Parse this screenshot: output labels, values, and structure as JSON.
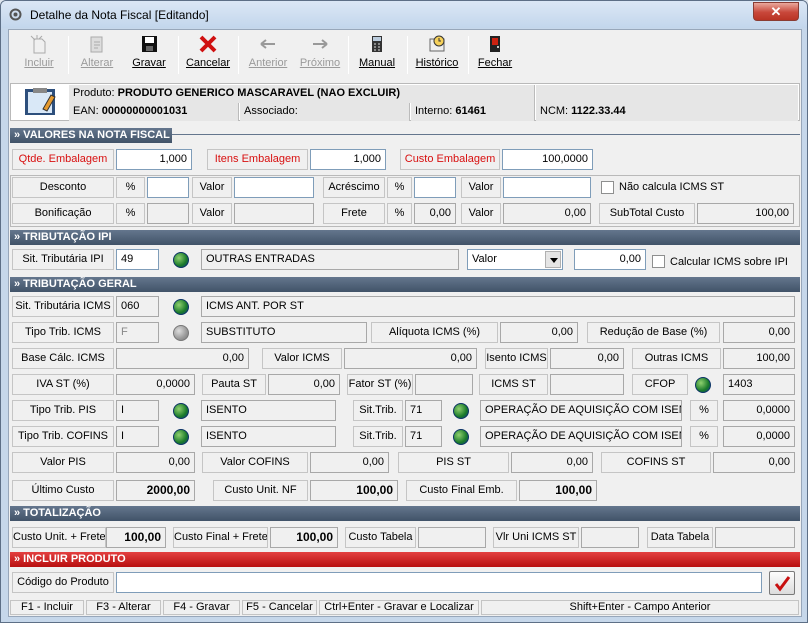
{
  "window": {
    "title": "Detalhe da Nota Fiscal [Editando]",
    "close_label": "✕"
  },
  "toolbar": {
    "incluir": "Incluir",
    "alterar": "Alterar",
    "gravar": "Gravar",
    "cancelar": "Cancelar",
    "anterior": "Anterior",
    "proximo": "Próximo",
    "manual": "Manual",
    "historico": "Histórico",
    "fechar": "Fechar"
  },
  "product": {
    "produto_label": "Produto:",
    "produto_value": "PRODUTO GENERICO MASCARAVEL (NAO EXCLUIR)",
    "ean_label": "EAN:",
    "ean_value": "00000000001031",
    "associado_label": "Associado:",
    "associado_value": "",
    "interno_label": "Interno:",
    "interno_value": "61461",
    "ncm_label": "NCM:",
    "ncm_value": "1122.33.44"
  },
  "valores": {
    "header": "» VALORES NA NOTA FISCAL",
    "qtde_label": "Qtde. Embalagem",
    "qtde_value": "1,000",
    "itens_label": "Itens Embalagem",
    "itens_value": "1,000",
    "custo_label": "Custo Embalagem",
    "custo_value": "100,0000",
    "desconto_label": "Desconto",
    "pct": "%",
    "valor_label": "Valor",
    "desconto_pct": "",
    "desconto_valor": "",
    "acrescimo_label": "Acréscimo",
    "acrescimo_pct": "",
    "acrescimo_valor": "",
    "nao_calcula_label": "Não calcula ICMS ST",
    "bonificacao_label": "Bonificação",
    "bonificacao_pct": "",
    "bonificacao_valor": "",
    "frete_label": "Frete",
    "frete_pct": "0,00",
    "frete_valor": "0,00",
    "subtotal_label": "SubTotal Custo",
    "subtotal_value": "100,00"
  },
  "ipi": {
    "header": "» TRIBUTAÇÃO IPI",
    "sit_label": "Sit. Tributária IPI",
    "sit_code": "49",
    "sit_desc": "OUTRAS ENTRADAS",
    "tipo_selected": "Valor",
    "valor": "0,00",
    "calcular_label": "Calcular ICMS sobre IPI"
  },
  "geral": {
    "header": "» TRIBUTAÇÃO  GERAL",
    "sit_icms_label": "Sit. Tributária ICMS",
    "sit_icms_code": "060",
    "sit_icms_desc": "ICMS ANT. POR ST",
    "tipo_icms_label": "Tipo Trib. ICMS",
    "tipo_icms_code": "F",
    "tipo_icms_desc": "SUBSTITUTO",
    "aliquota_label": "Alíquota ICMS (%)",
    "aliquota_value": "0,00",
    "reducao_label": "Redução de Base (%)",
    "reducao_value": "0,00",
    "base_label": "Base Cálc. ICMS",
    "base_value": "0,00",
    "valor_icms_label": "Valor ICMS",
    "valor_icms_value": "0,00",
    "isento_label": "Isento ICMS",
    "isento_value": "0,00",
    "outras_label": "Outras ICMS",
    "outras_value": "100,00",
    "iva_label": "IVA ST (%)",
    "iva_value": "0,0000",
    "pauta_label": "Pauta ST",
    "pauta_value": "0,00",
    "fator_label": "Fator ST (%)",
    "fator_value": "",
    "icms_st_label": "ICMS ST",
    "icms_st_value": "",
    "cfop_label": "CFOP",
    "cfop_value": "1403",
    "pis_label": "Tipo Trib. PIS",
    "pis_code": "I",
    "pis_desc": "ISENTO",
    "sittrib_label": "Sit.Trib.",
    "pis_sit_code": "71",
    "pis_sit_desc": "OPERAÇÃO DE AQUISIÇÃO COM ISEN",
    "pct": "%",
    "pis_pct": "0,0000",
    "cofins_label": "Tipo Trib. COFINS",
    "cofins_code": "I",
    "cofins_desc": "ISENTO",
    "cofins_sit_code": "71",
    "cofins_sit_desc": "OPERAÇÃO DE AQUISIÇÃO COM ISEN",
    "cofins_pct": "0,0000",
    "valor_pis_label": "Valor PIS",
    "valor_pis_value": "0,00",
    "valor_cofins_label": "Valor COFINS",
    "valor_cofins_value": "0,00",
    "pis_st_label": "PIS ST",
    "pis_st_value": "0,00",
    "cofins_st_label": "COFINS ST",
    "cofins_st_value": "0,00",
    "ultimo_label": "Último Custo",
    "ultimo_value": "2000,00",
    "custo_unit_nf_label": "Custo Unit. NF",
    "custo_unit_nf_value": "100,00",
    "custo_final_emb_label": "Custo Final Emb.",
    "custo_final_emb_value": "100,00"
  },
  "totalizacao": {
    "header": "» TOTALIZAÇÃO",
    "cu_frete_label": "Custo Unit. + Frete",
    "cu_frete_value": "100,00",
    "cf_frete_label": "Custo Final + Frete",
    "cf_frete_value": "100,00",
    "tabela_label": "Custo Tabela",
    "tabela_value": "",
    "vlr_uni_label": "Vlr Uni ICMS ST",
    "vlr_uni_value": "",
    "data_label": "Data Tabela",
    "data_value": ""
  },
  "incluir": {
    "header": "» INCLUIR PRODUTO",
    "codigo_label": "Código do Produto",
    "codigo_value": ""
  },
  "status": {
    "f1": "F1 - Incluir",
    "f3": "F3 - Alterar",
    "f4": "F4 - Gravar",
    "f5": "F5 - Cancelar",
    "ctrl": "Ctrl+Enter - Gravar e Localizar",
    "shift": "Shift+Enter - Campo Anterior"
  }
}
